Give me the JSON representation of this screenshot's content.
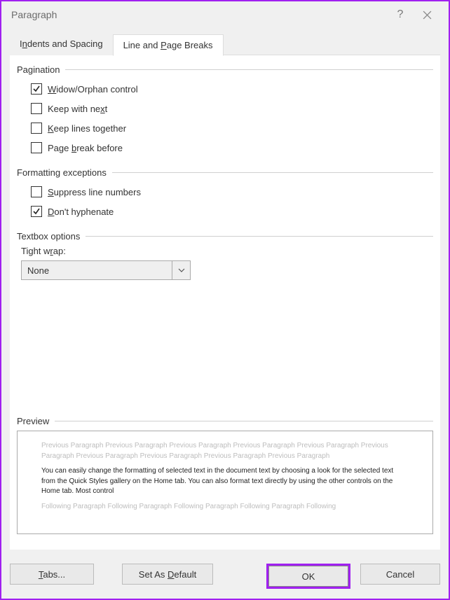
{
  "dialog": {
    "title": "Paragraph"
  },
  "tabs": {
    "indents": {
      "pre": "I",
      "u": "n",
      "post": "dents and Spacing"
    },
    "breaks": {
      "pre": "Line and ",
      "u": "P",
      "post": "age Breaks"
    }
  },
  "pagination": {
    "title": "Pagination",
    "widow": {
      "pre": "",
      "u": "W",
      "post": "idow/Orphan control",
      "checked": true
    },
    "keep_next": {
      "pre": "Keep with ne",
      "u": "x",
      "post": "t",
      "checked": false
    },
    "keep_tog": {
      "pre": "",
      "u": "K",
      "post": "eep lines together",
      "checked": false
    },
    "page_brk": {
      "pre": "Page ",
      "u": "b",
      "post": "reak before",
      "checked": false
    }
  },
  "formatting": {
    "title": "Formatting exceptions",
    "suppress": {
      "pre": "",
      "u": "S",
      "post": "uppress line numbers",
      "checked": false
    },
    "nohyph": {
      "pre": "",
      "u": "D",
      "post": "on't hyphenate",
      "checked": true
    }
  },
  "textbox": {
    "title": "Textbox options",
    "tightwrap_label": {
      "pre": "Tight w",
      "u": "r",
      "post": "ap:"
    },
    "tightwrap_value": "None"
  },
  "preview": {
    "title": "Preview",
    "prev": "Previous Paragraph Previous Paragraph Previous Paragraph Previous Paragraph Previous Paragraph Previous Paragraph Previous Paragraph Previous Paragraph Previous Paragraph Previous Paragraph",
    "main": "You can easily change the formatting of selected text in the document text by choosing a look for the selected text from the Quick Styles gallery on the Home tab. You can also format text directly by using the other controls on the Home tab. Most control",
    "next": "Following Paragraph Following Paragraph Following Paragraph Following Paragraph Following"
  },
  "buttons": {
    "tabs": {
      "pre": "",
      "u": "T",
      "post": "abs..."
    },
    "default": {
      "pre": "Set As ",
      "u": "D",
      "post": "efault"
    },
    "ok": "OK",
    "cancel": "Cancel"
  }
}
